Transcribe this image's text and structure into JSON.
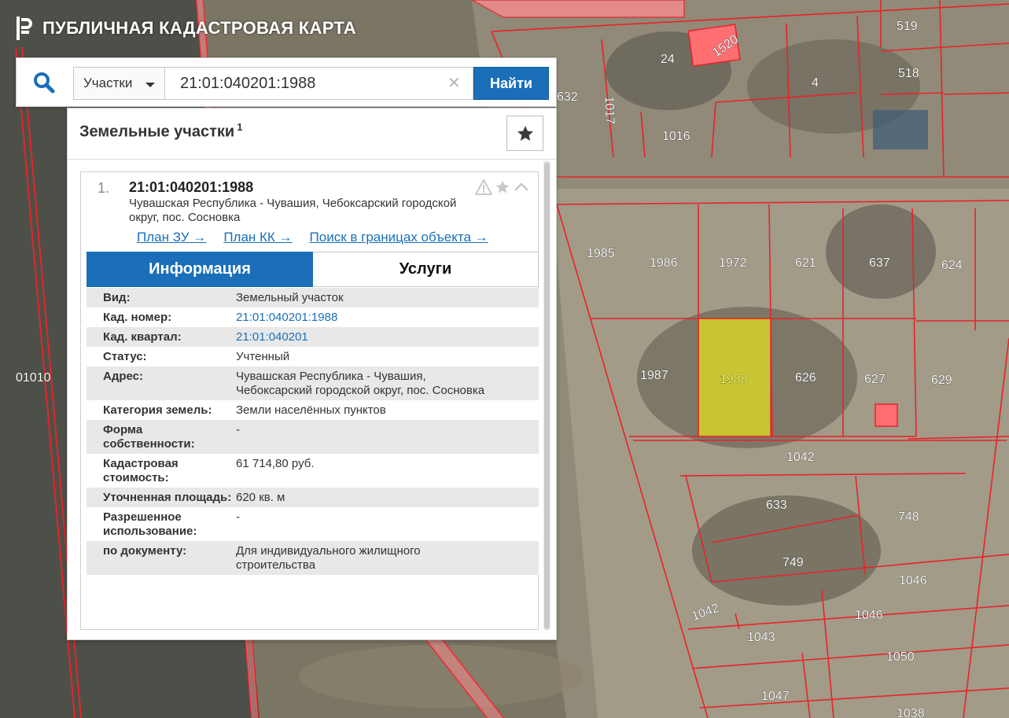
{
  "app": {
    "title": "ПУБЛИЧНАЯ КАДАСТРОВАЯ КАРТА"
  },
  "search": {
    "type_selected": "Участки",
    "query": "21:01:040201:1988",
    "button_label": "Найти"
  },
  "results": {
    "title": "Земельные участки",
    "count": "1",
    "items": [
      {
        "index": "1.",
        "cad_number": "21:01:040201:1988",
        "address": "Чувашская Республика - Чувашия, Чебоксарский городской округ, пос. Сосновка",
        "links": [
          "План ЗУ →",
          "План КК →",
          "Поиск в границах объекта →"
        ]
      }
    ]
  },
  "tabs": [
    {
      "label": "Информация",
      "active": true
    },
    {
      "label": "Услуги",
      "active": false
    }
  ],
  "info": [
    {
      "key": "Вид:",
      "value": "Земельный участок"
    },
    {
      "key": "Кад. номер:",
      "value": "21:01:040201:1988"
    },
    {
      "key": "Кад. квартал:",
      "value": "21:01:040201"
    },
    {
      "key": "Статус:",
      "value": "Учтенный"
    },
    {
      "key": "Адрес:",
      "value": "Чувашская Республика - Чувашия, Чебоксарский городской округ, пос. Сосновка"
    },
    {
      "key": "Категория земель:",
      "value": "Земли населённых пунктов"
    },
    {
      "key": "Форма собственности:",
      "value": "-"
    },
    {
      "key": "Кадастровая стоимость:",
      "value": "61 714,80 руб."
    },
    {
      "key": "Уточненная площадь:",
      "value": "620 кв. м"
    },
    {
      "key": "Разрешенное использование:",
      "value": "-"
    },
    {
      "key": "по документу:",
      "value": "Для индивидуального жилищного строительства"
    }
  ],
  "map": {
    "selected_parcel": "1988",
    "parcel_labels": [
      "519",
      "518",
      "24",
      "1520",
      "4",
      "632",
      "1017",
      "1016",
      "1985",
      "1986",
      "1972",
      "621",
      "637",
      "624",
      "1987",
      "1988",
      "626",
      "627",
      "629",
      "1042",
      "633",
      "748",
      "749",
      "1046",
      "1042",
      "1046",
      "1043",
      "1050",
      "1047",
      "1038",
      "01010"
    ],
    "colors": {
      "boundary": "#e8232a",
      "selected_fill": "#e0e020",
      "building_fill": "#ff6f72",
      "accent": "#1a6fb8"
    }
  },
  "icons": [
    "logo-icon",
    "search-icon",
    "clear-icon",
    "star-icon",
    "warning-icon",
    "chevron-up-icon"
  ]
}
